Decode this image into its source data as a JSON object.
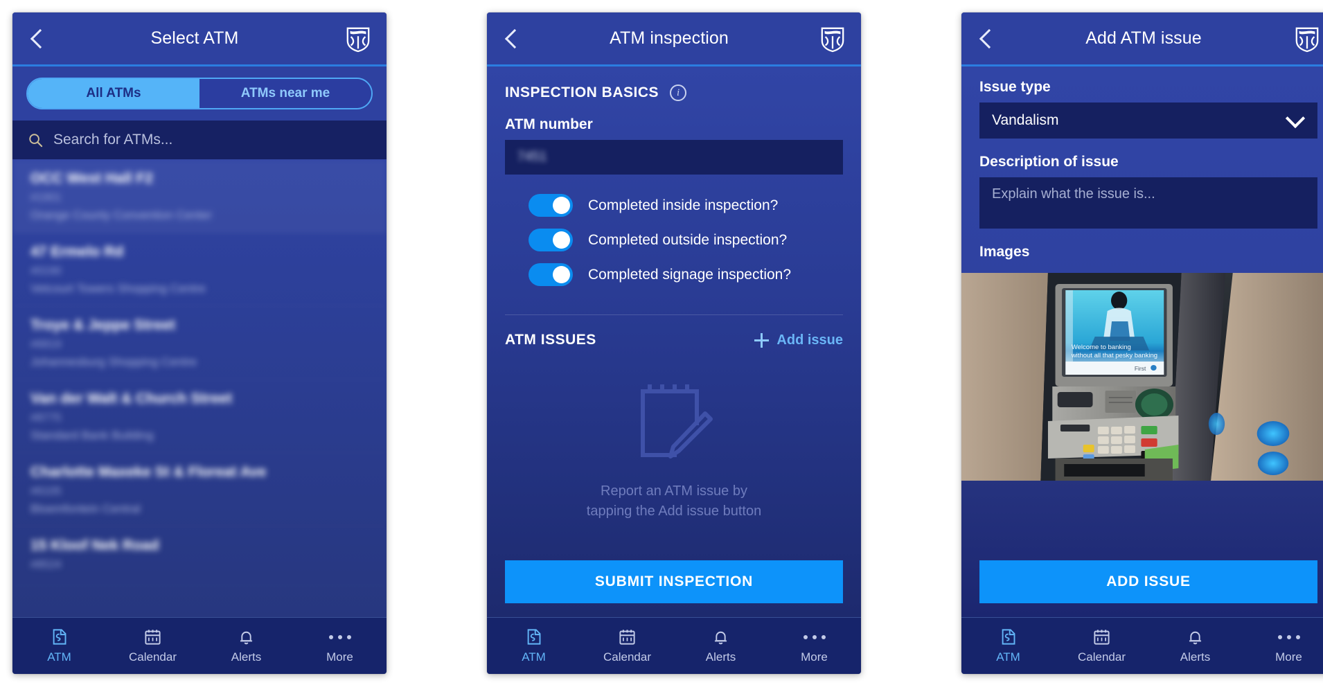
{
  "app": {
    "brand_logo": "standard-bank-shield-icon",
    "accent_blue": "#0d93fa",
    "header_blue": "#2e41a0",
    "nav_blue": "#16246b"
  },
  "tabbar": {
    "items": [
      {
        "label": "ATM",
        "icon": "atm-icon",
        "active": true
      },
      {
        "label": "Calendar",
        "icon": "calendar-icon",
        "active": false
      },
      {
        "label": "Alerts",
        "icon": "bell-icon",
        "active": false
      },
      {
        "label": "More",
        "icon": "ellipsis-icon",
        "active": false
      }
    ]
  },
  "screen1": {
    "title": "Select ATM",
    "back_icon": "chevron-left-icon",
    "segments": [
      {
        "label": "All ATMs",
        "selected": true
      },
      {
        "label": "ATMs near me",
        "selected": false
      }
    ],
    "search": {
      "placeholder": "Search for ATMs...",
      "icon": "search-icon",
      "value": ""
    },
    "atms": [
      {
        "name": "OCC West Hall F2",
        "id": "#1901",
        "place": "Orange County Convention Center"
      },
      {
        "name": "47 Ermelo Rd",
        "id": "#0190",
        "place": "Vetcourt Towers Shopping Centre"
      },
      {
        "name": "Troye & Jeppe Street",
        "id": "#6819",
        "place": "Johannesburg Shopping Centre"
      },
      {
        "name": "Van der Walt & Church Street",
        "id": "#8775",
        "place": "Standard Bank Building"
      },
      {
        "name": "Charlotte Maxeke St & Floreat Ave",
        "id": "#6105",
        "place": "Bloemfontein Central"
      },
      {
        "name": "15 Kloof Nek Road",
        "id": "#8524",
        "place": ""
      }
    ]
  },
  "screen2": {
    "title": "ATM inspection",
    "back_icon": "chevron-left-icon",
    "section_basics": "INSPECTION BASICS",
    "info_icon": "info-icon",
    "atm_number_label": "ATM number",
    "atm_number_value": "7451",
    "toggles": [
      {
        "label": "Completed inside inspection?",
        "on": true
      },
      {
        "label": "Completed outside inspection?",
        "on": true
      },
      {
        "label": "Completed signage inspection?",
        "on": true
      }
    ],
    "section_issues": "ATM ISSUES",
    "add_issue_label": "Add issue",
    "add_issue_icon": "plus-icon",
    "empty_icon": "notepad-pencil-icon",
    "empty_line1": "Report an ATM issue by",
    "empty_line2": "tapping the Add issue button",
    "submit_label": "SUBMIT INSPECTION"
  },
  "screen3": {
    "title": "Add ATM issue",
    "back_icon": "chevron-left-icon",
    "issue_type_label": "Issue type",
    "issue_type_value": "Vandalism",
    "issue_type_chevron": "chevron-down-icon",
    "description_label": "Description of issue",
    "description_placeholder": "Explain what the issue is...",
    "description_value": "",
    "images_label": "Images",
    "photo_alt": "atm-machine-photo",
    "photo_screen_line1": "Welcome to banking",
    "photo_screen_line2": "without all that pesky banking",
    "add_issue_button": "ADD ISSUE"
  }
}
